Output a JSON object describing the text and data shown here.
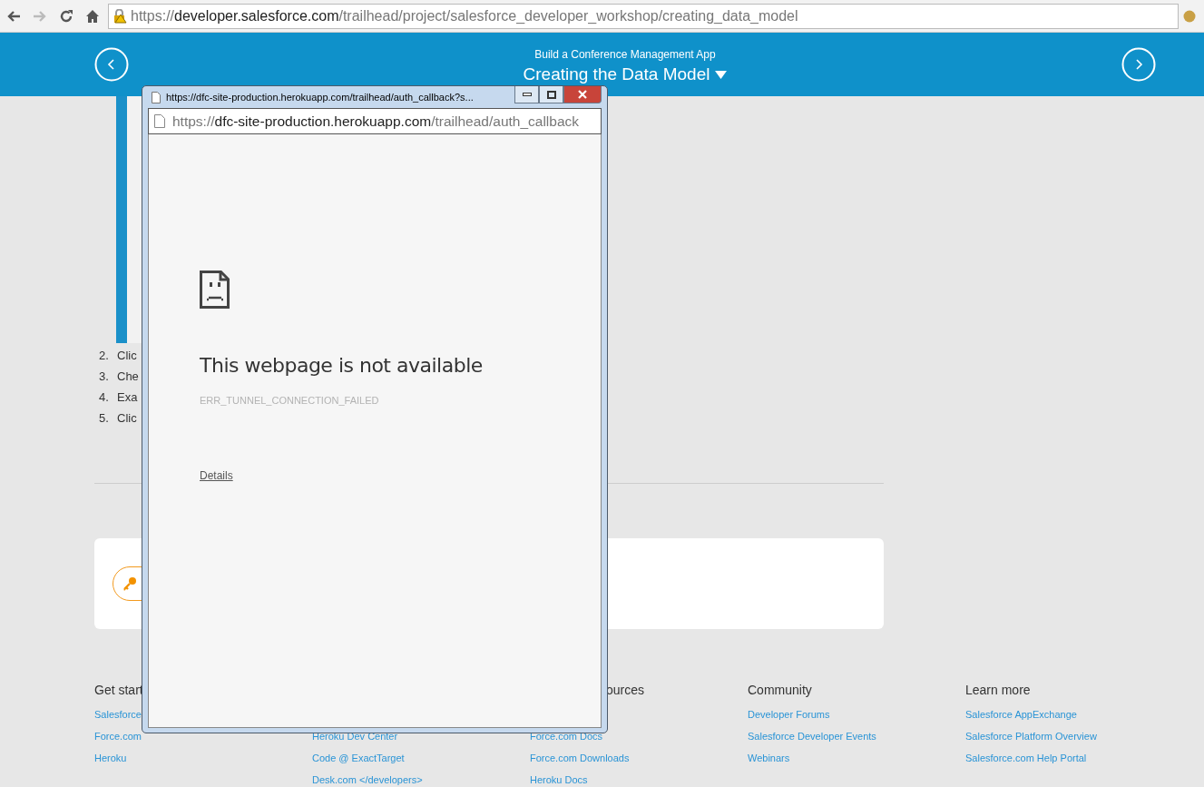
{
  "browser": {
    "url": [
      {
        "kind": "dim",
        "text": "https://"
      },
      {
        "kind": "host",
        "text": "developer.salesforce.com"
      },
      {
        "kind": "dim",
        "text": "/trailhead/project/salesforce_developer_workshop/creating_data_model"
      }
    ]
  },
  "banner": {
    "subtitle": "Build a Conference Management App",
    "title": "Creating the Data Model"
  },
  "article": {
    "steps": [
      {
        "number": "2.",
        "text": "Clic"
      },
      {
        "number": "3.",
        "text": "Che"
      },
      {
        "number": "4.",
        "text": "Exa"
      },
      {
        "number": "5.",
        "text": "Clic"
      }
    ]
  },
  "footer": {
    "columns": [
      {
        "heading": "Get start",
        "links": [
          "Salesforce",
          "Force.com",
          "Heroku"
        ]
      },
      {
        "links": [
          "Heroku Dev Center",
          "Code @ ExactTarget",
          "Desk.com </developers>"
        ]
      },
      {
        "heading": "ources",
        "links": [
          "Force.com Docs",
          "Force.com Downloads",
          "Heroku Docs"
        ]
      },
      {
        "heading": "Community",
        "links": [
          "Developer Forums",
          "Salesforce Developer Events",
          "Webinars"
        ]
      },
      {
        "heading": "Learn more",
        "links": [
          "Salesforce AppExchange",
          "Salesforce Platform Overview",
          "Salesforce.com Help Portal"
        ]
      }
    ]
  },
  "popup": {
    "title": "https://dfc-site-production.herokuapp.com/trailhead/auth_callback?s...",
    "url": [
      {
        "kind": "dim",
        "text": "https://"
      },
      {
        "kind": "host",
        "text": "dfc-site-production.herokuapp.com"
      },
      {
        "kind": "dim",
        "text": "/trailhead/auth_callback"
      }
    ],
    "error": {
      "heading": "This webpage is not available",
      "code": "ERR_TUNNEL_CONNECTION_FAILED",
      "link": "Details"
    }
  }
}
